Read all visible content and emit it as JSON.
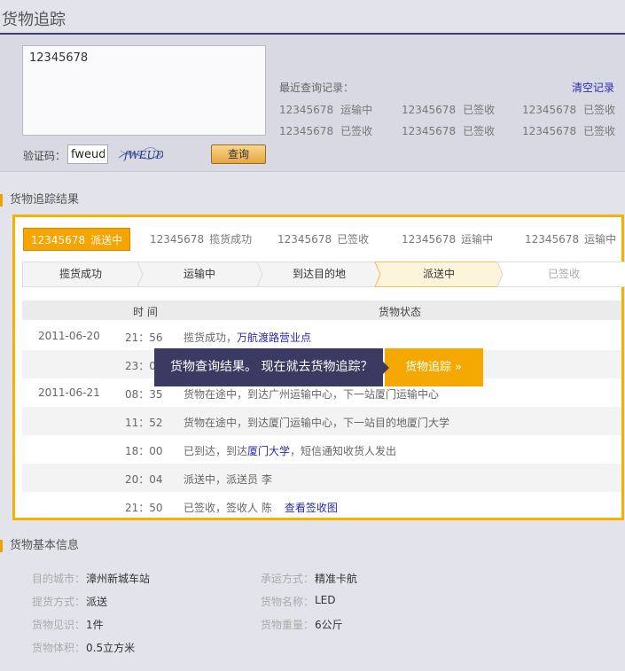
{
  "page": {
    "title": "货物追踪"
  },
  "search": {
    "query_value": "12345678",
    "captcha_label": "验证码：",
    "captcha_value": "fweud",
    "captcha_image_text": "fWEUD",
    "query_button": "查询",
    "recent_label": "最近查询记录：",
    "clear_label": "清空记录",
    "recent": [
      {
        "id": "12345678",
        "status": "运输中"
      },
      {
        "id": "12345678",
        "status": "已签收"
      },
      {
        "id": "12345678",
        "status": "已签收"
      },
      {
        "id": "12345678",
        "status": "已签收"
      },
      {
        "id": "12345678",
        "status": "已签收"
      },
      {
        "id": "12345678",
        "status": "已签收"
      }
    ]
  },
  "tracking": {
    "heading": "货物追踪结果",
    "tabs": [
      {
        "id": "12345678",
        "status": "派送中"
      },
      {
        "id": "12345678",
        "status": "揽货成功"
      },
      {
        "id": "12345678",
        "status": "已签收"
      },
      {
        "id": "12345678",
        "status": "运输中"
      },
      {
        "id": "12345678",
        "status": "运输中"
      }
    ],
    "steps": [
      "揽货成功",
      "运输中",
      "到达目的地",
      "派送中",
      "已签收"
    ],
    "current_step_index": 3,
    "header_time": "时 间",
    "header_status": "货物状态",
    "rows": [
      {
        "date": "2011-06-20",
        "time": "21：56",
        "text": "揽货成功，",
        "link": "万航渡路营业点",
        "tail": ""
      },
      {
        "date": "",
        "time": "23：0",
        "text": "",
        "link": "",
        "tail": ""
      },
      {
        "date": "2011-06-21",
        "time": "08：35",
        "text": "货物在途中，到达广州运输中心，下一站厦门运输中心",
        "link": "",
        "tail": ""
      },
      {
        "date": "",
        "time": "11：52",
        "text": "货物在途中，到达厦门运输中心，下一站目的地厦门大学",
        "link": "",
        "tail": ""
      },
      {
        "date": "",
        "time": "18：00",
        "text": "已到达，到达",
        "link": "厦门大学",
        "tail": "，短信通知收货人发出"
      },
      {
        "date": "",
        "time": "20：04",
        "text": "派送中，派送员 李",
        "link": "",
        "tail": ""
      },
      {
        "date": "",
        "time": "21：50",
        "text": "已签收，签收人 陈",
        "link": "查看签收图",
        "tail": ""
      }
    ],
    "popup_text": "货物查询结果。 现在就去货物追踪？",
    "popup_button": "货物追踪 »"
  },
  "info": {
    "heading": "货物基本信息",
    "items": [
      {
        "label": "目的城市：",
        "value": "漳州新城车站"
      },
      {
        "label": "承运方式：",
        "value": "精准卡航"
      },
      {
        "label": "提货方式：",
        "value": "派送"
      },
      {
        "label": "货物名称：",
        "value": "LED"
      },
      {
        "label": "货物见识：",
        "value": "1件"
      },
      {
        "label": "货物重量：",
        "value": "6公斤"
      },
      {
        "label": "货物体积：",
        "value": "0.5立方米"
      }
    ]
  },
  "colors": {
    "accent": "#f5a900",
    "brand_dark": "#3b3a62",
    "link": "#2a2ab0"
  }
}
